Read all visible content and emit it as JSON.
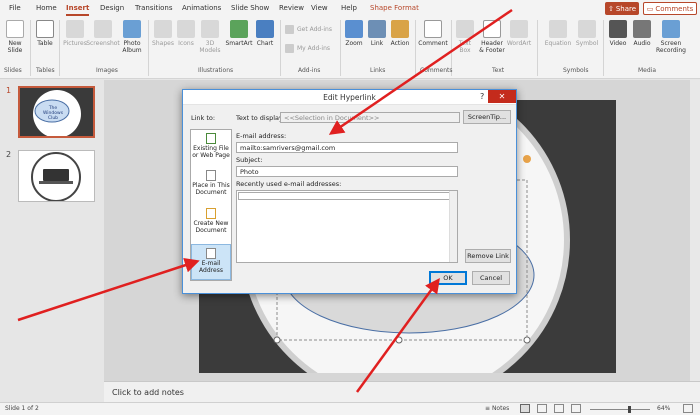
{
  "ribbon_tabs": [
    "File",
    "Home",
    "Insert",
    "Design",
    "Transitions",
    "Animations",
    "Slide Show",
    "Review",
    "View",
    "Help",
    "Shape Format"
  ],
  "share_label": "Share",
  "comments_label": "Comments",
  "ribbon": {
    "new_slide": "New Slide",
    "table": "Table",
    "pictures": "Pictures",
    "screenshot": "Screenshot",
    "photo_album": "Photo Album",
    "shapes": "Shapes",
    "icons": "Icons",
    "models": "3D Models",
    "smartart": "SmartArt",
    "chart": "Chart",
    "get_addins": "Get Add-ins",
    "my_addins": "My Add-ins",
    "zoom": "Zoom",
    "link": "Link",
    "action": "Action",
    "comment": "Comment",
    "text_box": "Text Box",
    "header_footer": "Header & Footer",
    "wordart": "WordArt",
    "equation": "Equation",
    "symbol": "Symbol",
    "video": "Video",
    "audio": "Audio",
    "screen_recording": "Screen Recording",
    "groups": [
      "Slides",
      "Tables",
      "Images",
      "Illustrations",
      "Add-ins",
      "Links",
      "Comments",
      "Text",
      "Symbols",
      "Media"
    ]
  },
  "thumbnails": {
    "slide1_number": "1",
    "slide1_text": "The Windows Club",
    "slide2_number": "2"
  },
  "dialog": {
    "title": "Edit Hyperlink",
    "help": "?",
    "close": "✕",
    "link_to_label": "Link to:",
    "text_to_display_label": "Text to display:",
    "text_to_display_value": "<<Selection in Document>>",
    "screentip_button": "ScreenTip...",
    "email_label": "E-mail address:",
    "email_value": "mailto:samrivers@gmail.com",
    "subject_label": "Subject:",
    "subject_value": "Photo",
    "recent_label": "Recently used e-mail addresses:",
    "remove_link": "Remove Link",
    "ok": "OK",
    "cancel": "Cancel",
    "link_options": [
      {
        "label": "Existing File or Web Page"
      },
      {
        "label": "Place in This Document"
      },
      {
        "label": "Create New Document"
      },
      {
        "label": "E-mail Address"
      }
    ]
  },
  "notes_placeholder": "Click to add notes",
  "status": {
    "slide_of": "Slide 1 of 2",
    "notes": "Notes",
    "zoom": "64%"
  },
  "colors": {
    "accent": "#b7472a",
    "arrow": "#e02020",
    "selection": "#cce4f7"
  }
}
